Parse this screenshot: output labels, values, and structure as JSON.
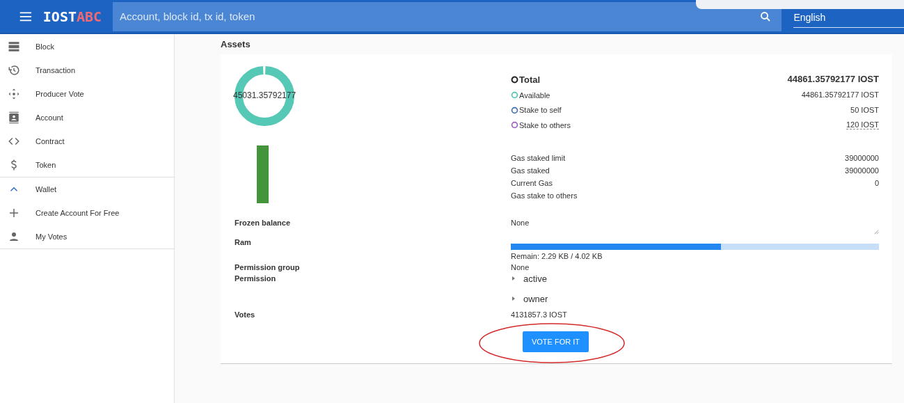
{
  "header": {
    "logo_main": "IOST",
    "logo_accent": "ABC",
    "search": {
      "placeholder": "Account, block id, tx id, token"
    },
    "language": "English"
  },
  "sidebar": {
    "groups": [
      {
        "items": [
          {
            "label": "Block"
          },
          {
            "label": "Transaction"
          },
          {
            "label": "Producer Vote"
          },
          {
            "label": "Account"
          },
          {
            "label": "Contract"
          },
          {
            "label": "Token"
          }
        ]
      },
      {
        "items": [
          {
            "label": "Wallet",
            "expanded": true
          },
          {
            "label": "Create Account For Free"
          },
          {
            "label": "My Votes"
          }
        ]
      }
    ]
  },
  "assets": {
    "title": "Assets",
    "donut_label": "45031.35792177",
    "balances": [
      {
        "label": "Total",
        "value": "44861.35792177 IOST",
        "kind": "total",
        "color": "#222222",
        "dashed": false
      },
      {
        "label": "Available",
        "value": "44861.35792177 IOST",
        "kind": "item",
        "color": "#4fc3b0",
        "dashed": false
      },
      {
        "label": "Stake to self",
        "value": "50 IOST",
        "kind": "item",
        "color": "#3e6fb5",
        "dashed": false
      },
      {
        "label": "Stake to others",
        "value": "120 IOST",
        "kind": "item",
        "color": "#a25bc4",
        "dashed": true
      }
    ],
    "gas": [
      {
        "label": "Gas staked limit",
        "value": "39000000"
      },
      {
        "label": "Gas staked",
        "value": "39000000"
      },
      {
        "label": "Current Gas",
        "value": "0"
      },
      {
        "label": "Gas stake to others"
      }
    ],
    "frozen_balance": {
      "label": "Frozen balance",
      "value": "None"
    },
    "ram": {
      "label": "Ram",
      "level": 0.57,
      "reading": "Remain: 2.29 KB / 4.02 KB"
    },
    "permission_group": {
      "label": "Permission group",
      "value": "None"
    },
    "permission": {
      "label": "Permission",
      "items": [
        {
          "label": "active",
          "expanded": false
        },
        {
          "label": "owner",
          "expanded": false
        }
      ]
    },
    "votes": {
      "label": "Votes",
      "value": "4131857.3 IOST"
    },
    "vote_button": "VOTE FOR IT"
  }
}
